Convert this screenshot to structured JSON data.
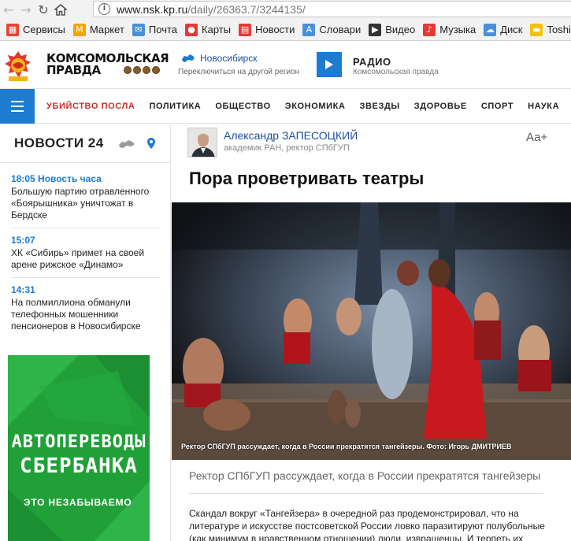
{
  "browser": {
    "url_host": "www.nsk.kp.ru",
    "url_path": "/daily/26363.7/3244135/",
    "bookmarks": [
      {
        "label": "Сервисы",
        "icon": "apps-grid-icon",
        "color": "#e94235"
      },
      {
        "label": "Маркет",
        "icon": "market-icon",
        "color": "#f2a500"
      },
      {
        "label": "Почта",
        "icon": "mail-icon",
        "color": "#4a90d9"
      },
      {
        "label": "Карты",
        "icon": "map-pin-icon",
        "color": "#e53935"
      },
      {
        "label": "Новости",
        "icon": "news-icon",
        "color": "#e53935"
      },
      {
        "label": "Словари",
        "icon": "dictionary-icon",
        "color": "#4a90d9"
      },
      {
        "label": "Видео",
        "icon": "video-icon",
        "color": "#333333"
      },
      {
        "label": "Музыка",
        "icon": "music-icon",
        "color": "#e53935"
      },
      {
        "label": "Диск",
        "icon": "disk-icon",
        "color": "#4a90d9"
      },
      {
        "label": "Toshiba",
        "icon": "folder-icon",
        "color": "#f2c200"
      }
    ]
  },
  "header": {
    "brand_line1": "КОМСОМОЛЬСКАЯ",
    "brand_line2": "ПРАВДА",
    "region_name": "Новосибирск",
    "region_switch": "Переключиться на другой регион",
    "radio_title": "РАДИО",
    "radio_sub": "Комсомольская правда"
  },
  "nav": {
    "items": [
      {
        "label": "УБИЙСТВО ПОСЛА",
        "hot": true
      },
      {
        "label": "ПОЛИТИКА",
        "hot": false
      },
      {
        "label": "ОБЩЕСТВО",
        "hot": false
      },
      {
        "label": "ЭКОНОМИКА",
        "hot": false
      },
      {
        "label": "ЗВЕЗДЫ",
        "hot": false
      },
      {
        "label": "ЗДОРОВЬЕ",
        "hot": false
      },
      {
        "label": "СПОРТ",
        "hot": false
      },
      {
        "label": "НАУКА",
        "hot": false
      },
      {
        "label": "АВТ",
        "hot": false
      }
    ]
  },
  "news24": {
    "title": "НОВОСТИ 24",
    "items": [
      {
        "time": "18:05 Новость часа",
        "text": "Большую партию отравленного «Боярышника» уничтожат в Бердске"
      },
      {
        "time": "15:07",
        "text": "ХК «Сибирь» примет на своей арене рижское «Динамо»"
      },
      {
        "time": "14:31",
        "text": "На полмиллиона обманули телефонных мошенники пенсионеров в Новосибирске"
      }
    ]
  },
  "ad": {
    "line1": "АВТОПЕРЕВОДЫ",
    "line2": "СБЕРБАНКА",
    "slogan": "ЭТО НЕЗАБЫВАЕМО",
    "color": "#21a039"
  },
  "article": {
    "author_name": "Александр ЗАПЕСОЦКИЙ",
    "author_title": "академик РАН, ректор СПбГУП",
    "font_size_control": "Аа+",
    "title": "Пора проветривать театры",
    "photo_caption": "Ректор СПбГУП рассуждает, когда в России прекратятся тангейзеры. Фото: Игорь ДМИТРИЕВ",
    "lead": "Ректор СПбГУП рассуждает, когда в России прекратятся тангейзеры",
    "body": "Скандал вокруг «Тангейзера» в очередной раз продемонстрировал, что на литературе и искусстве постсоветской России ловко паразитируют полубольные (как минимум в нравственном отношении) люди, извращенцы. И терпеть их"
  },
  "colors": {
    "accent_blue": "#1d7bd0",
    "hot_red": "#c9302c",
    "link_blue": "#1a4f9c"
  }
}
